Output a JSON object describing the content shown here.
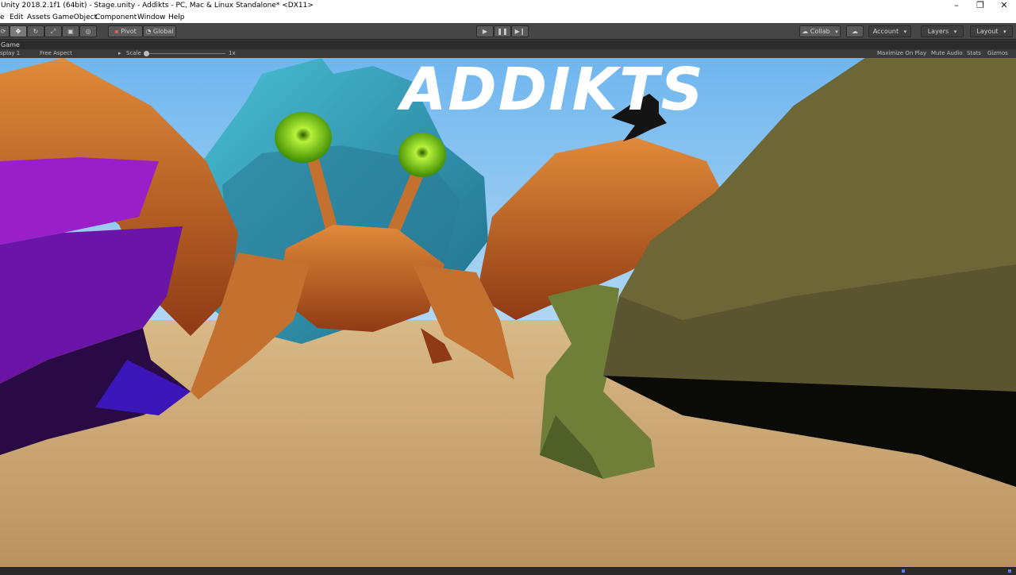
{
  "window": {
    "title": "Unity 2018.2.1f1 (64bit) - Stage.unity - Addikts - PC, Mac & Linux Standalone* <DX11>",
    "min_icon": "minimize-icon",
    "max_icon": "restore-icon",
    "close_icon": "close-icon"
  },
  "menu": {
    "items": [
      "e",
      "Edit",
      "Assets",
      "GameObject",
      "Component",
      "Window",
      "Help"
    ]
  },
  "toolbar": {
    "pivot": "Pivot",
    "global": "Global",
    "collab": "Collab",
    "account": "Account",
    "layers": "Layers",
    "layout": "Layout"
  },
  "tab": {
    "label": "Game"
  },
  "gamebar": {
    "display": "splay 1",
    "aspect": "Free Aspect",
    "scale_label": "Scale",
    "scale_value": "1x",
    "maximize": "Maximize On Play",
    "mute": "Mute Audio",
    "stats": "Stats",
    "gizmos": "Gizmos"
  },
  "game": {
    "logo": "ADDIKTS"
  },
  "colors": {
    "sky": "#8fc7f0",
    "sand": "#c9a877",
    "crab": "#c0622a",
    "shell": "#3a9fb8",
    "eye": "#7ddf1a",
    "crystal": "#7a1fb0",
    "rock": "#6a6432",
    "accent": "#5a7aff"
  }
}
